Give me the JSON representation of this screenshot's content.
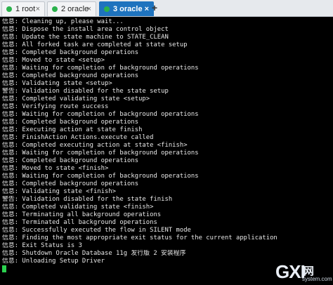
{
  "tabs": [
    {
      "label": "1 root",
      "dot_color": "#2bb24c",
      "active": false
    },
    {
      "label": "2 oracle",
      "dot_color": "#2bb24c",
      "active": false
    },
    {
      "label": "3 oracle",
      "dot_color": "#2bb24c",
      "active": true
    }
  ],
  "close_symbol": "×",
  "new_tab_symbol": "+",
  "terminal": {
    "lines": [
      "信息: Cleaning up, please wait...",
      "信息: Dispose the install area control object",
      "信息: Update the state machine to STATE_CLEAN",
      "信息: All forked task are completed at state setup",
      "信息: Completed background operations",
      "信息: Moved to state <setup>",
      "信息: Waiting for completion of background operations",
      "信息: Completed background operations",
      "信息: Validating state <setup>",
      "警告: Validation disabled for the state setup",
      "信息: Completed validating state <setup>",
      "信息: Verifying route success",
      "信息: Waiting for completion of background operations",
      "信息: Completed background operations",
      "信息: Executing action at state finish",
      "信息: FinishAction Actions.execute called",
      "信息: Completed executing action at state <finish>",
      "信息: Waiting for completion of background operations",
      "信息: Completed background operations",
      "信息: Moved to state <finish>",
      "信息: Waiting for completion of background operations",
      "信息: Completed background operations",
      "信息: Validating state <finish>",
      "警告: Validation disabled for the state finish",
      "信息: Completed validating state <finish>",
      "信息: Terminating all background operations",
      "信息: Terminated all background operations",
      "信息: Successfully executed the flow in SILENT mode",
      "信息: Finding the most appropriate exit status for the current application",
      "信息: Exit Status is 3",
      "信息: Shutdown Oracle Database 11g 发行版 2 安装程序",
      "信息: Unloading Setup Driver"
    ],
    "cursor_color": "#2bd14f"
  },
  "watermark": {
    "logo": "GXI",
    "net": "网",
    "site": "system.com"
  }
}
